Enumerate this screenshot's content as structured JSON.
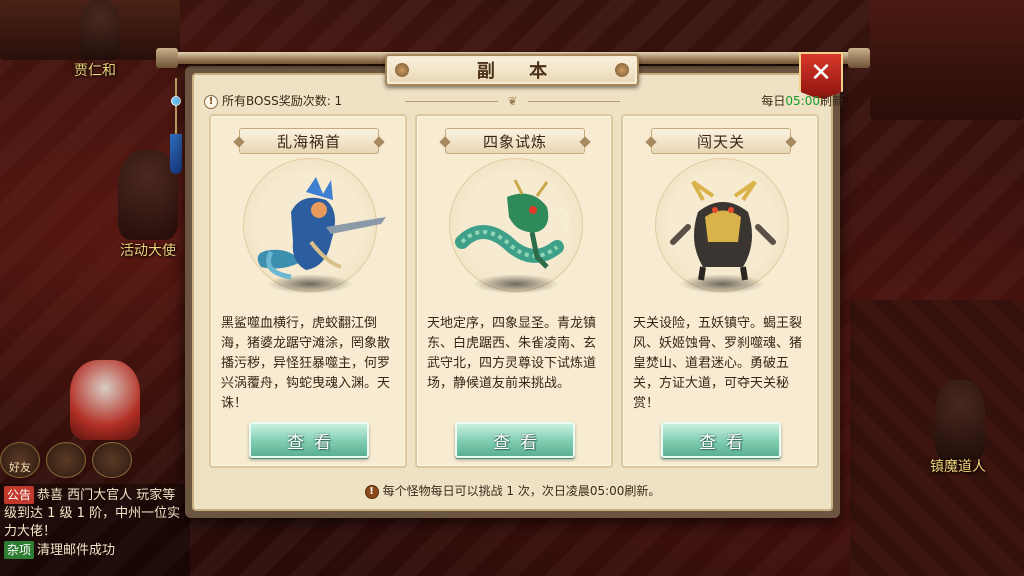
{
  "scene": {
    "npcs": [
      "贾仁和",
      "活动大使",
      "镇魔道人"
    ]
  },
  "chat": {
    "quick_icons": [
      "好友",
      "",
      ""
    ],
    "lines": [
      {
        "tag": "公告",
        "tag_color": "#c0392b",
        "text": "恭喜 西门大官人 玩家等级到达 1 级 1 阶，中州一位实力大佬！"
      },
      {
        "tag": "杂项",
        "tag_color": "#2e7d32",
        "text": "清理邮件成功"
      }
    ]
  },
  "dialog": {
    "title": "副 本",
    "close_label": "✕",
    "boss_reward_label": "所有BOSS奖励次数: 1",
    "refresh_prefix": "每日",
    "refresh_time": "05:00",
    "refresh_suffix": "刷新",
    "footer_note": "每个怪物每日可以挑战 1 次，次日凌晨05:00刷新。",
    "cards": [
      {
        "title": "乱海祸首",
        "description": "黑鲨噬血横行，虎蛟翻江倒海，猪婆龙踞守滩涂，罔象散播污秽，异怪狂暴噬主，何罗兴涡覆舟，钩蛇曳魂入渊。天诛！",
        "button": "查看",
        "monster_icon": "sea-dragon-warrior-icon"
      },
      {
        "title": "四象试炼",
        "description": "天地定序，四象显圣。青龙镇东、白虎踞西、朱雀凌南、玄武守北，四方灵尊设下试炼道场，静候道友前来挑战。",
        "button": "查看",
        "monster_icon": "green-dragon-icon"
      },
      {
        "title": "闯天关",
        "description": "天关设险，五妖镇守。蝎王裂风、妖姬蚀骨、罗刹噬魂、猪皇焚山、道君迷心。勇破五关，方证大道，可夺天关秘赏！",
        "button": "查看",
        "monster_icon": "armored-beast-icon"
      }
    ]
  },
  "colors": {
    "refresh_time": "#1a9a2a",
    "view_button": "#7fcdb0",
    "close_button": "#c62a1e"
  }
}
